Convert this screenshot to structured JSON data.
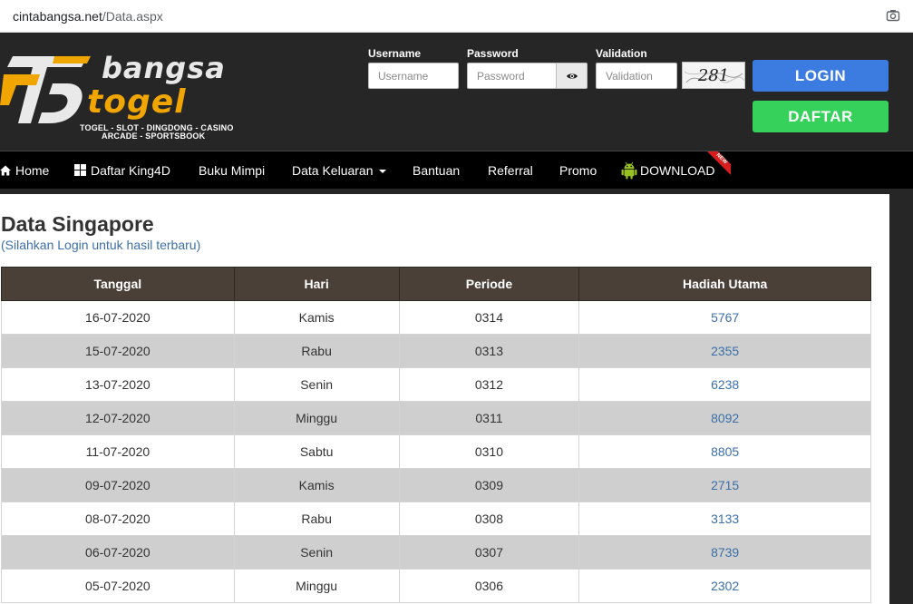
{
  "browser": {
    "host": "cintabangsa.net",
    "path": "/Data.aspx",
    "camera_icon": "camera-icon"
  },
  "brand": {
    "word1": "bangsa",
    "word2": "togel",
    "tagline1": "TOGEL - SLOT - DINGDONG - CASINO",
    "tagline2": "ARCADE - SPORTSBOOK",
    "accent": "#f0a500"
  },
  "login_form": {
    "username_label": "Username",
    "username_placeholder": "Username",
    "password_label": "Password",
    "password_placeholder": "Password",
    "validation_label": "Validation",
    "validation_placeholder": "Validation",
    "captcha_text": "281",
    "login_label": "LOGIN",
    "register_label": "DAFTAR",
    "login_color": "#3c7be0",
    "register_color": "#35d15a"
  },
  "nav": {
    "items": [
      {
        "label": "Home",
        "icon": "home-icon"
      },
      {
        "label": "Daftar King4D",
        "icon": "windows-icon"
      },
      {
        "label": "Buku Mimpi"
      },
      {
        "label": "Data Keluaran",
        "icon": "chevron-down-icon"
      },
      {
        "label": "Bantuan"
      },
      {
        "label": "Referral"
      },
      {
        "label": "Promo"
      },
      {
        "label": "DOWNLOAD",
        "icon": "android-icon"
      }
    ],
    "new_badge": "NEW"
  },
  "main": {
    "title": "Data Singapore",
    "subtitle": "(Silahkan Login untuk hasil terbaru)",
    "table": {
      "headers": [
        "Tanggal",
        "Hari",
        "Periode",
        "Hadiah Utama"
      ],
      "rows": [
        [
          "16-07-2020",
          "Kamis",
          "0314",
          "5767"
        ],
        [
          "15-07-2020",
          "Rabu",
          "0313",
          "2355"
        ],
        [
          "13-07-2020",
          "Senin",
          "0312",
          "6238"
        ],
        [
          "12-07-2020",
          "Minggu",
          "0311",
          "8092"
        ],
        [
          "11-07-2020",
          "Sabtu",
          "0310",
          "8805"
        ],
        [
          "09-07-2020",
          "Kamis",
          "0309",
          "2715"
        ],
        [
          "08-07-2020",
          "Rabu",
          "0308",
          "3133"
        ],
        [
          "06-07-2020",
          "Senin",
          "0307",
          "8739"
        ],
        [
          "05-07-2020",
          "Minggu",
          "0306",
          "2302"
        ]
      ]
    }
  }
}
